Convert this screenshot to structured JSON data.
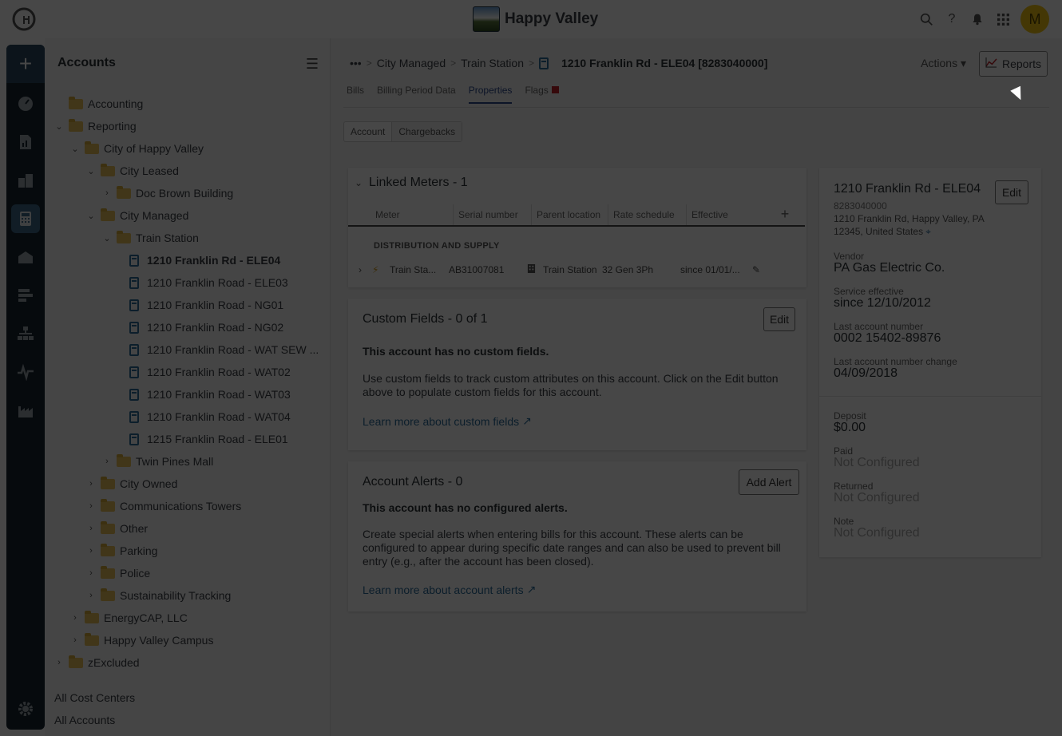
{
  "app": {
    "title": "Happy Valley",
    "avatar_letter": "M"
  },
  "rail": {
    "items": [
      "add-icon",
      "dashboard-icon",
      "reports-chart-icon",
      "buildings-icon",
      "calculator-icon",
      "inbox-icon",
      "gantt-icon",
      "hierarchy-icon",
      "pulse-icon",
      "factory-icon",
      "settings-icon"
    ]
  },
  "tree": {
    "title": "Accounts",
    "nodes": [
      {
        "label": "Accounting",
        "depth": 0,
        "kind": "folder",
        "chevron": ""
      },
      {
        "label": "Reporting",
        "depth": 0,
        "kind": "folder",
        "chevron": "v"
      },
      {
        "label": "City of Happy Valley",
        "depth": 1,
        "kind": "folder",
        "chevron": "v"
      },
      {
        "label": "City Leased",
        "depth": 2,
        "kind": "folder",
        "chevron": "v"
      },
      {
        "label": "Doc Brown Building",
        "depth": 3,
        "kind": "folder",
        "chevron": ">"
      },
      {
        "label": "City Managed",
        "depth": 2,
        "kind": "folder",
        "chevron": "v"
      },
      {
        "label": "Train Station",
        "depth": 3,
        "kind": "folder",
        "chevron": "v"
      },
      {
        "label": "1210 Franklin Rd - ELE04",
        "depth": 4,
        "kind": "account",
        "selected": true
      },
      {
        "label": "1210 Franklin Road - ELE03",
        "depth": 4,
        "kind": "account"
      },
      {
        "label": "1210 Franklin Road - NG01",
        "depth": 4,
        "kind": "account"
      },
      {
        "label": "1210 Franklin Road - NG02",
        "depth": 4,
        "kind": "account"
      },
      {
        "label": "1210 Franklin Road - WAT SEW ...",
        "depth": 4,
        "kind": "account"
      },
      {
        "label": "1210 Franklin Road - WAT02",
        "depth": 4,
        "kind": "account"
      },
      {
        "label": "1210 Franklin Road - WAT03",
        "depth": 4,
        "kind": "account"
      },
      {
        "label": "1210 Franklin Road - WAT04",
        "depth": 4,
        "kind": "account"
      },
      {
        "label": "1215 Franklin Road - ELE01",
        "depth": 4,
        "kind": "account"
      },
      {
        "label": "Twin Pines Mall",
        "depth": 3,
        "kind": "folder",
        "chevron": ">"
      },
      {
        "label": "City Owned",
        "depth": 2,
        "kind": "folder",
        "chevron": ">"
      },
      {
        "label": "Communications Towers",
        "depth": 2,
        "kind": "folder",
        "chevron": ">"
      },
      {
        "label": "Other",
        "depth": 2,
        "kind": "folder",
        "chevron": ">"
      },
      {
        "label": "Parking",
        "depth": 2,
        "kind": "folder",
        "chevron": ">"
      },
      {
        "label": "Police",
        "depth": 2,
        "kind": "folder",
        "chevron": ">"
      },
      {
        "label": "Sustainability Tracking",
        "depth": 2,
        "kind": "folder",
        "chevron": ">"
      },
      {
        "label": "EnergyCAP, LLC",
        "depth": 1,
        "kind": "folder",
        "chevron": ">"
      },
      {
        "label": "Happy Valley Campus",
        "depth": 1,
        "kind": "folder",
        "chevron": ">"
      },
      {
        "label": "zExcluded",
        "depth": 0,
        "kind": "folder",
        "chevron": ">"
      }
    ],
    "footer": [
      "All Cost Centers",
      "All Accounts"
    ]
  },
  "breadcrumb": {
    "ellipsis": "•••",
    "items": [
      "City Managed",
      "Train Station"
    ],
    "current": "1210 Franklin Rd - ELE04 [8283040000]"
  },
  "header": {
    "actions_label": "Actions",
    "reports_label": "Reports"
  },
  "tabs": [
    "Bills",
    "Billing Period Data",
    "Properties",
    "Flags"
  ],
  "subtabs": [
    "Account",
    "Chargebacks"
  ],
  "linked_meters": {
    "title": "Linked Meters - 1",
    "columns": [
      "Meter",
      "Serial number",
      "Parent location",
      "Rate schedule",
      "Effective"
    ],
    "group": "DISTRIBUTION AND SUPPLY",
    "row": {
      "meter": "Train Sta...",
      "serial": "AB31007081",
      "parent": "Train Station",
      "rate": "32 Gen 3Ph",
      "effective": "since 01/01/..."
    }
  },
  "custom_fields": {
    "title": "Custom Fields - 0 of 1",
    "edit_label": "Edit",
    "empty_title": "This account has no custom fields.",
    "body": "Use custom fields to track custom attributes on this account. Click on the Edit button above to populate custom fields for this account.",
    "link": "Learn more about custom fields"
  },
  "alerts": {
    "title": "Account Alerts - 0",
    "add_label": "Add Alert",
    "empty_title": "This account has no configured alerts.",
    "body": "Create special alerts when entering bills for this account. These alerts can be configured to appear during specific date ranges and can also be used to prevent bill entry (e.g., after the account has been closed).",
    "link": "Learn more about account alerts"
  },
  "details": {
    "name": "1210 Franklin Rd - ELE04",
    "edit_label": "Edit",
    "number": "8283040000",
    "address_line1": "1210 Franklin Rd, Happy Valley, PA",
    "address_line2": "12345, United States",
    "fields": [
      {
        "label": "Vendor",
        "value": "PA Gas Electric Co."
      },
      {
        "label": "Service effective",
        "value": "since 12/10/2012"
      },
      {
        "label": "Last account number",
        "value": "0002 15402-89876"
      },
      {
        "label": "Last account number change",
        "value": "04/09/2018"
      }
    ],
    "fields2": [
      {
        "label": "Deposit",
        "value": "$0.00",
        "muted": false
      },
      {
        "label": "Paid",
        "value": "Not Configured",
        "muted": true
      },
      {
        "label": "Returned",
        "value": "Not Configured",
        "muted": true
      },
      {
        "label": "Note",
        "value": "Not Configured",
        "muted": true
      }
    ]
  },
  "colors": {
    "rail_bg": "#16252f",
    "accent": "#2b6d9c",
    "folder": "#e8c25a",
    "avatar": "#f3c613",
    "flag": "#c0202a"
  }
}
